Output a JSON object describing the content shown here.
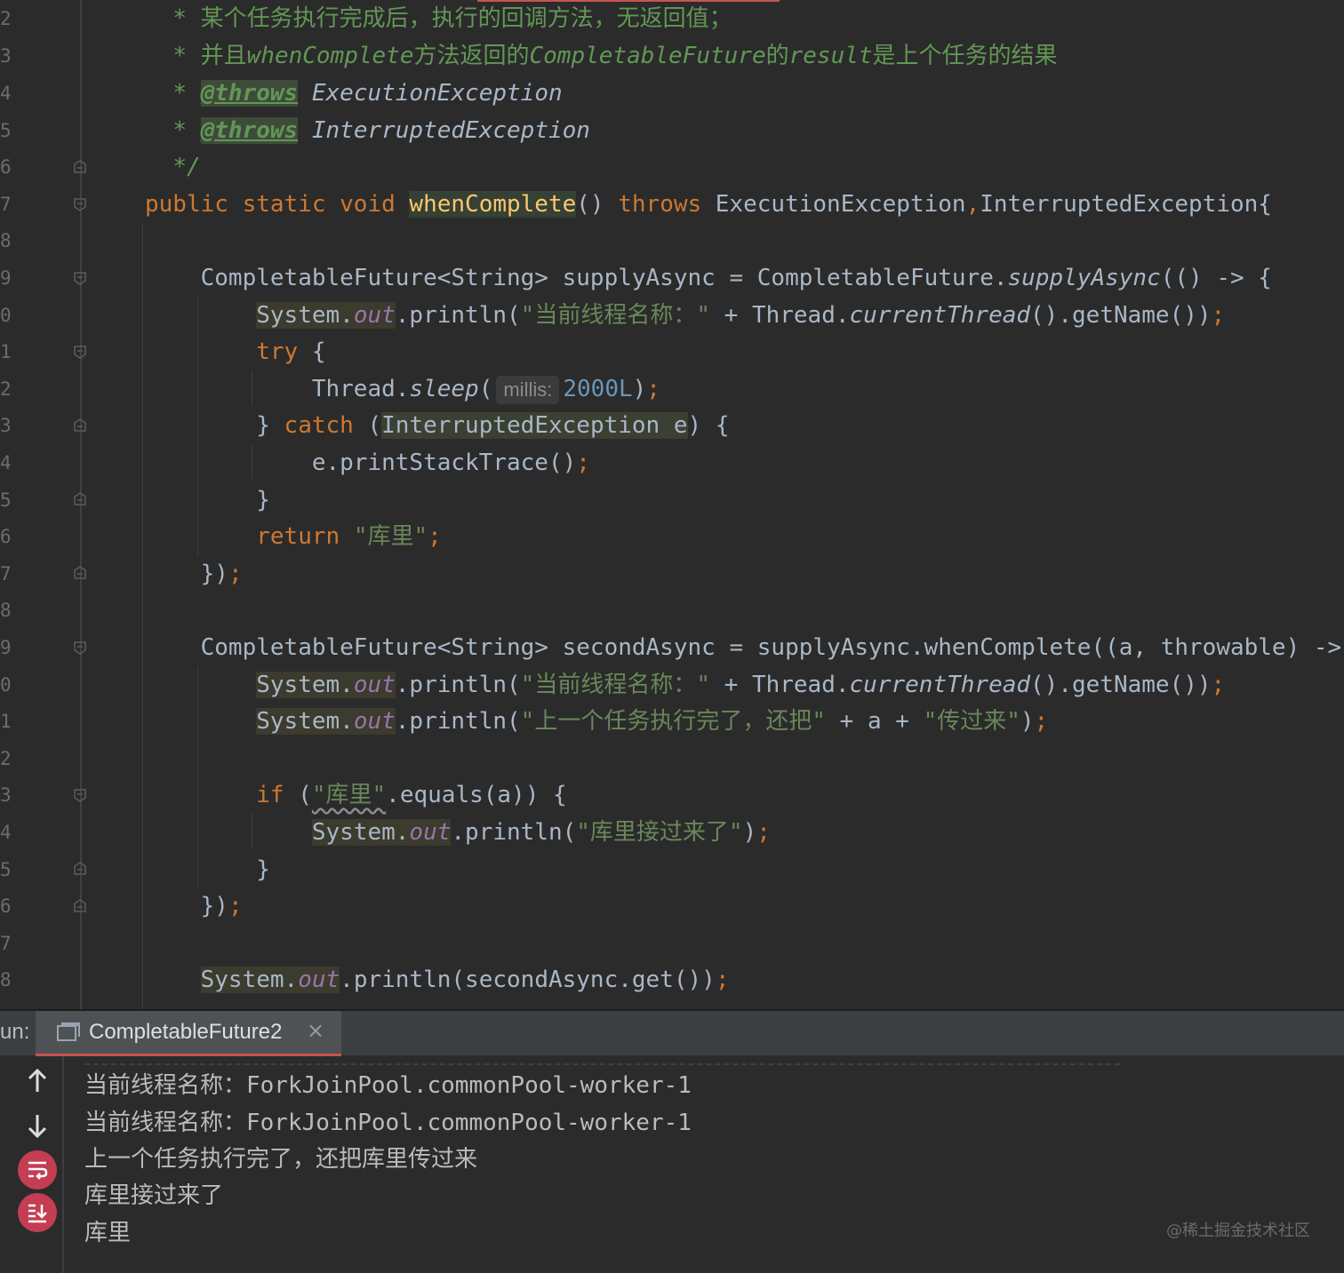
{
  "editor": {
    "line_numbers": [
      "2",
      "3",
      "4",
      "5",
      "6",
      "7",
      "8",
      "9",
      "0",
      "1",
      "2",
      "3",
      "4",
      "5",
      "6",
      "7",
      "8",
      "9",
      "0",
      "1",
      "2",
      "3",
      "4",
      "5",
      "6",
      "7",
      "8"
    ],
    "comment1": "某个任务执行完成后，执行的回调方法，无返回值；",
    "comment2_a": "并且",
    "comment2_b": "whenComplete",
    "comment2_c": "方法返回的",
    "comment2_d": "CompletableFuture",
    "comment2_e": "的",
    "comment2_f": "result",
    "comment2_g": "是上个任务的结果",
    "throws_tag": "@throws",
    "throws1": "ExecutionException",
    "throws2": "InterruptedException",
    "comment_end": "*/",
    "star": "*",
    "sig_modifiers": "public static void ",
    "sig_name": "whenComplete",
    "sig_parens": "()",
    "sig_throws": "throws",
    "sig_ex": " ExecutionException",
    "sig_comma": ",",
    "sig_ex2": "InterruptedException{",
    "l9_a": "CompletableFuture<String> supplyAsync = CompletableFuture.",
    "l9_b": "supplyAsync",
    "l9_c": "(() -> {",
    "sys": "System.",
    "out": "out",
    "println_open": ".println(",
    "str_thread": "\"当前线程名称：\"",
    "plus_thread": " + Thread.",
    "current_thread": "currentThread",
    "getname": "().getName())",
    "semi": ";",
    "try": "try",
    "brace_open": " {",
    "thread_sleep": "Thread.",
    "sleep": "sleep",
    "paren_open": "(",
    "hint_millis": "millis:",
    "millis_value": "2000L",
    "paren_close": ")",
    "close_brace": "}",
    "catch": "catch",
    "catch_open": " (",
    "catch_var": "InterruptedException e",
    "catch_close": ") {",
    "print_stack": "e.printStackTrace()",
    "return": "return",
    "return_str": "\"库里\"",
    "close_lambda": "})",
    "l19_a": "CompletableFuture<String> secondAsync = supplyAsync.whenComplete((a, throwable) -> {",
    "str_prev": "\"上一个任务执行完了，还把\"",
    "plus_a": " + a + ",
    "str_pass": "\"传过来\"",
    "close_paren": ")",
    "if": "if",
    "if_open": " (",
    "if_str": "\"库里\"",
    "if_rest": ".equals(a)) {",
    "str_caught": "\"库里接过来了\"",
    "final_rest": ".println(secondAsync.get())"
  },
  "run_panel": {
    "label": "un:",
    "tab_title": "CompletableFuture2",
    "close_glyph": "×",
    "output": [
      "当前线程名称：ForkJoinPool.commonPool-worker-1",
      "当前线程名称：ForkJoinPool.commonPool-worker-1",
      "上一个任务执行完了，还把库里传过来",
      "库里接过来了",
      "库里"
    ]
  },
  "watermark": "@稀土掘金技术社区",
  "colors": {
    "background": "#2b2b2b",
    "keyword": "#cc7832",
    "string": "#6a8759",
    "comment": "#629755",
    "number": "#6897bb",
    "field": "#9876aa",
    "method_decl": "#ffc66d",
    "tab_accent": "#c75450"
  }
}
